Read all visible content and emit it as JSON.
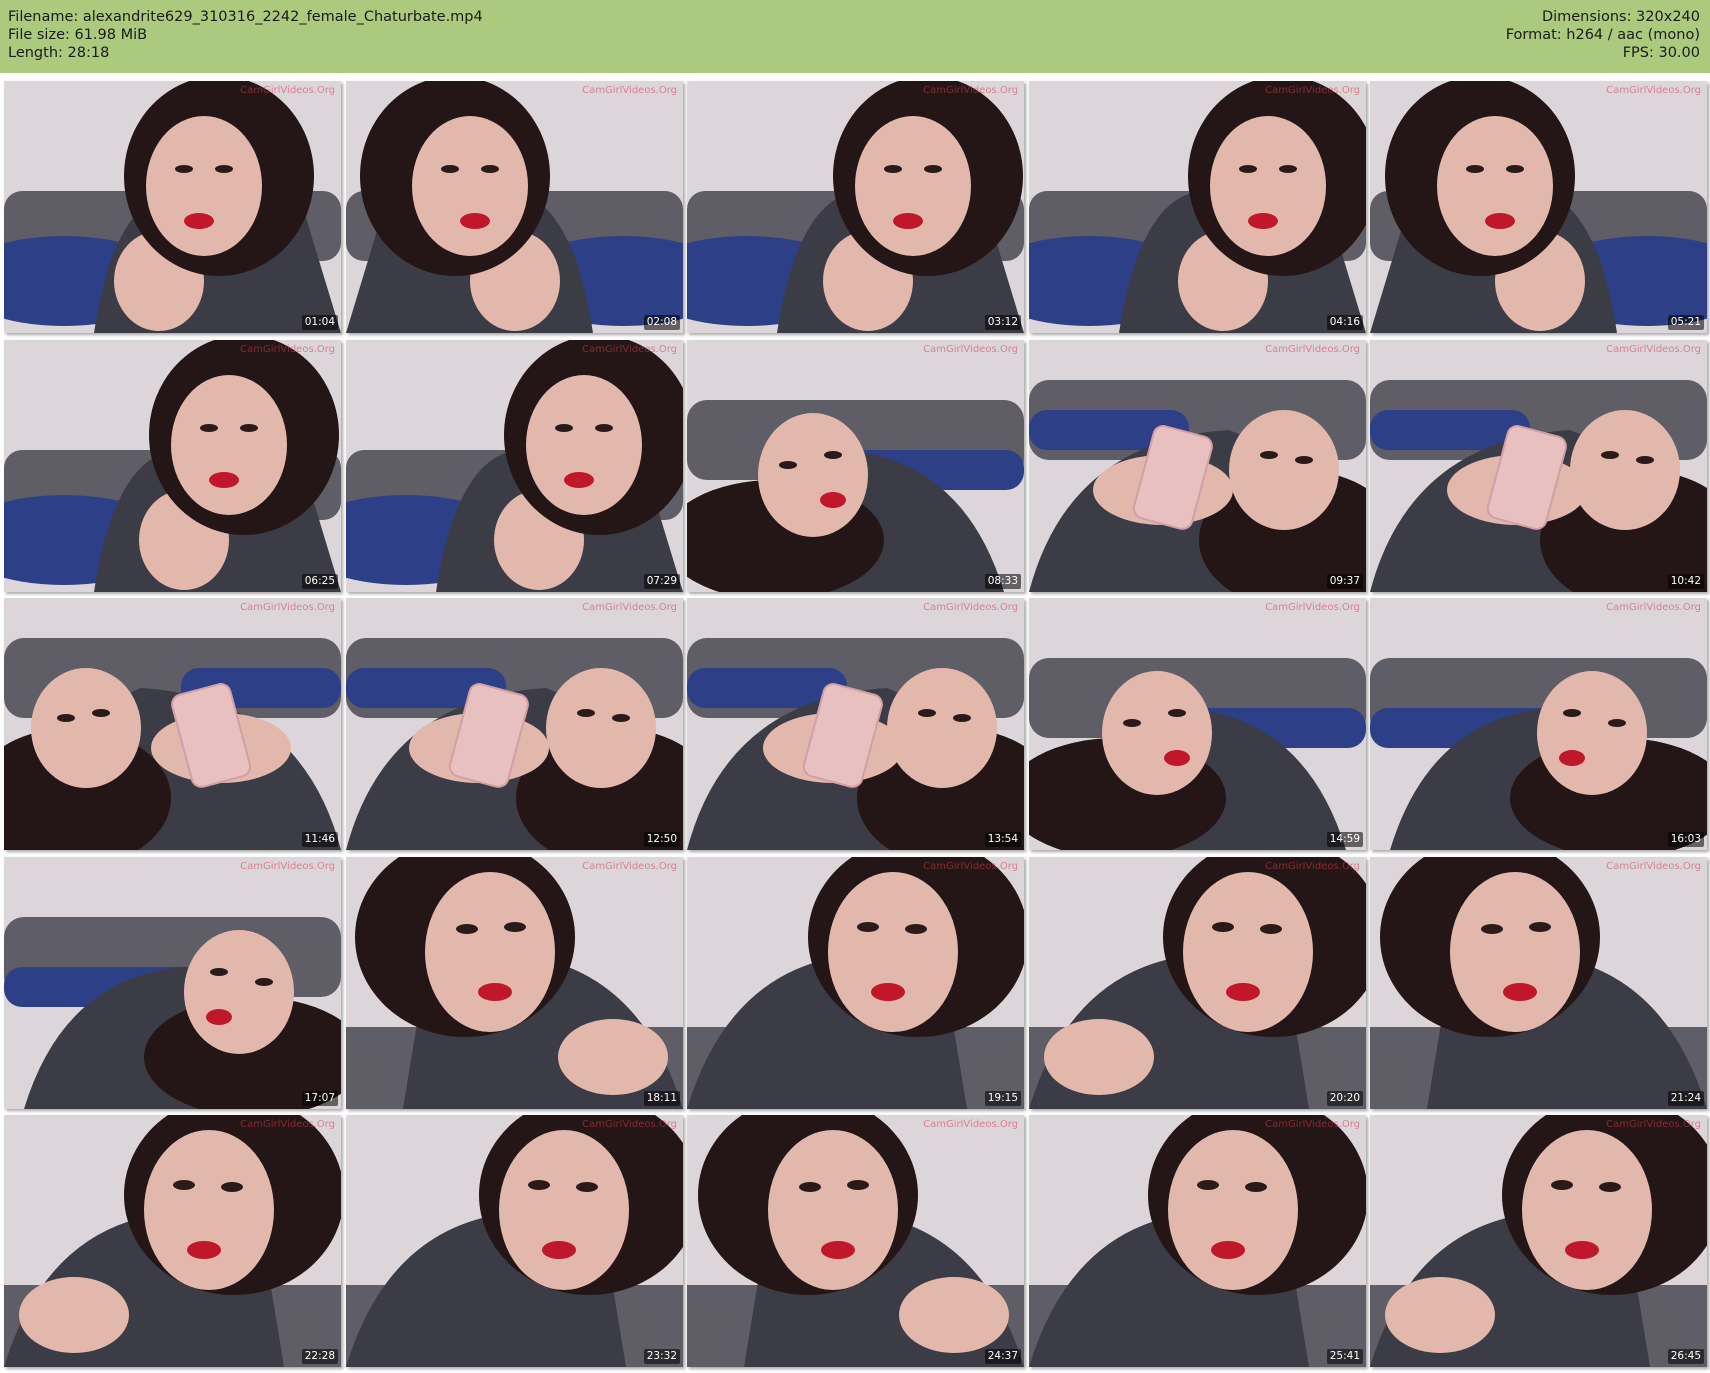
{
  "header": {
    "left": [
      "Filename: alexandrite629_310316_2242_female_Chaturbate.mp4",
      "File size: 61.98 MiB",
      "Length: 28:18"
    ],
    "right": [
      "Dimensions: 320x240",
      "Format: h264 / aac (mono)",
      "FPS: 30.00"
    ]
  },
  "watermark": "CamGirlVideos.Org",
  "thumbnails": [
    {
      "time": "01:04",
      "scene": "portrait"
    },
    {
      "time": "02:08",
      "scene": "portrait"
    },
    {
      "time": "03:12",
      "scene": "portrait"
    },
    {
      "time": "04:16",
      "scene": "portrait"
    },
    {
      "time": "05:21",
      "scene": "portrait"
    },
    {
      "time": "06:25",
      "scene": "portrait"
    },
    {
      "time": "07:29",
      "scene": "portrait"
    },
    {
      "time": "08:33",
      "scene": "lying"
    },
    {
      "time": "09:37",
      "scene": "phone"
    },
    {
      "time": "10:42",
      "scene": "phone"
    },
    {
      "time": "11:46",
      "scene": "phone"
    },
    {
      "time": "12:50",
      "scene": "phone"
    },
    {
      "time": "13:54",
      "scene": "phone"
    },
    {
      "time": "14:59",
      "scene": "lying"
    },
    {
      "time": "16:03",
      "scene": "lying"
    },
    {
      "time": "17:07",
      "scene": "lying"
    },
    {
      "time": "18:11",
      "scene": "closeup"
    },
    {
      "time": "19:15",
      "scene": "closeup"
    },
    {
      "time": "20:20",
      "scene": "closeup"
    },
    {
      "time": "21:24",
      "scene": "closeup"
    },
    {
      "time": "22:28",
      "scene": "closeup"
    },
    {
      "time": "23:32",
      "scene": "closeup"
    },
    {
      "time": "24:37",
      "scene": "closeup"
    },
    {
      "time": "25:41",
      "scene": "closeup"
    },
    {
      "time": "26:45",
      "scene": "closeup"
    }
  ],
  "colors": {
    "header_bg": "#acca7e",
    "wall": "#dcd6da",
    "couch": "#5f5d66",
    "jeans": "#2d3f86",
    "skin": "#e2b8ad",
    "hair": "#241616",
    "dress": "#3c3c46",
    "lips": "#c0182a",
    "phone": "#e9c0c0"
  }
}
